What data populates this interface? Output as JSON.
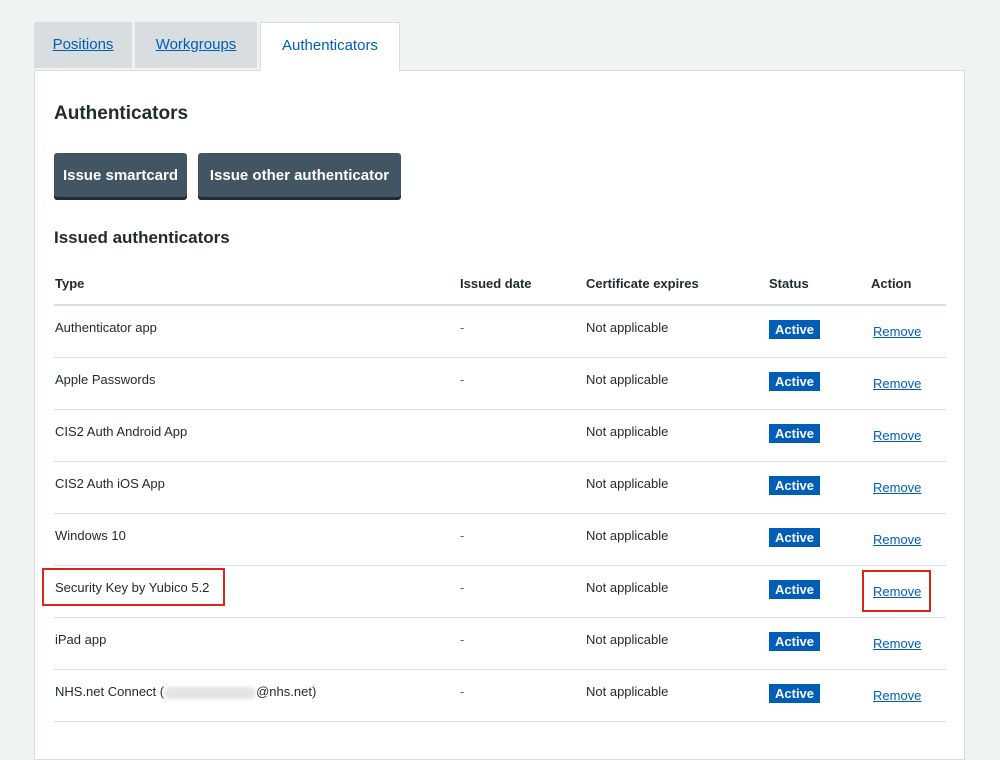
{
  "tabs": [
    {
      "label": "Positions",
      "active": false
    },
    {
      "label": "Workgroups",
      "active": false
    },
    {
      "label": "Authenticators",
      "active": true
    }
  ],
  "panel": {
    "title": "Authenticators",
    "buttons": {
      "issue_smartcard": "Issue smartcard",
      "issue_other": "Issue other authenticator"
    }
  },
  "issued": {
    "title": "Issued authenticators",
    "columns": {
      "type": "Type",
      "issued_date": "Issued date",
      "cert_expires": "Certificate expires",
      "status": "Status",
      "action": "Action"
    },
    "rows": [
      {
        "type": "Authenticator app",
        "issued_date": "-",
        "cert_expires": "Not applicable",
        "status": "Active",
        "action": "Remove"
      },
      {
        "type": "Apple Passwords",
        "issued_date": "-",
        "cert_expires": "Not applicable",
        "status": "Active",
        "action": "Remove"
      },
      {
        "type": "CIS2 Auth Android App",
        "issued_date": "",
        "cert_expires": "Not applicable",
        "status": "Active",
        "action": "Remove"
      },
      {
        "type": "CIS2 Auth iOS App",
        "issued_date": "",
        "cert_expires": "Not applicable",
        "status": "Active",
        "action": "Remove"
      },
      {
        "type": "Windows 10",
        "issued_date": "-",
        "cert_expires": "Not applicable",
        "status": "Active",
        "action": "Remove"
      },
      {
        "type": "Security Key by Yubico 5.2",
        "issued_date": "-",
        "cert_expires": "Not applicable",
        "status": "Active",
        "action": "Remove"
      },
      {
        "type": "iPad app",
        "issued_date": "-",
        "cert_expires": "Not applicable",
        "status": "Active",
        "action": "Remove"
      },
      {
        "type_prefix": "NHS.net Connect (",
        "type_suffix": "@nhs.net)",
        "issued_date": "-",
        "cert_expires": "Not applicable",
        "status": "Active",
        "action": "Remove"
      }
    ]
  },
  "colors": {
    "primary": "#005eb8",
    "button": "#425563",
    "highlight": "#d5281b",
    "background": "#f0f3f4"
  }
}
